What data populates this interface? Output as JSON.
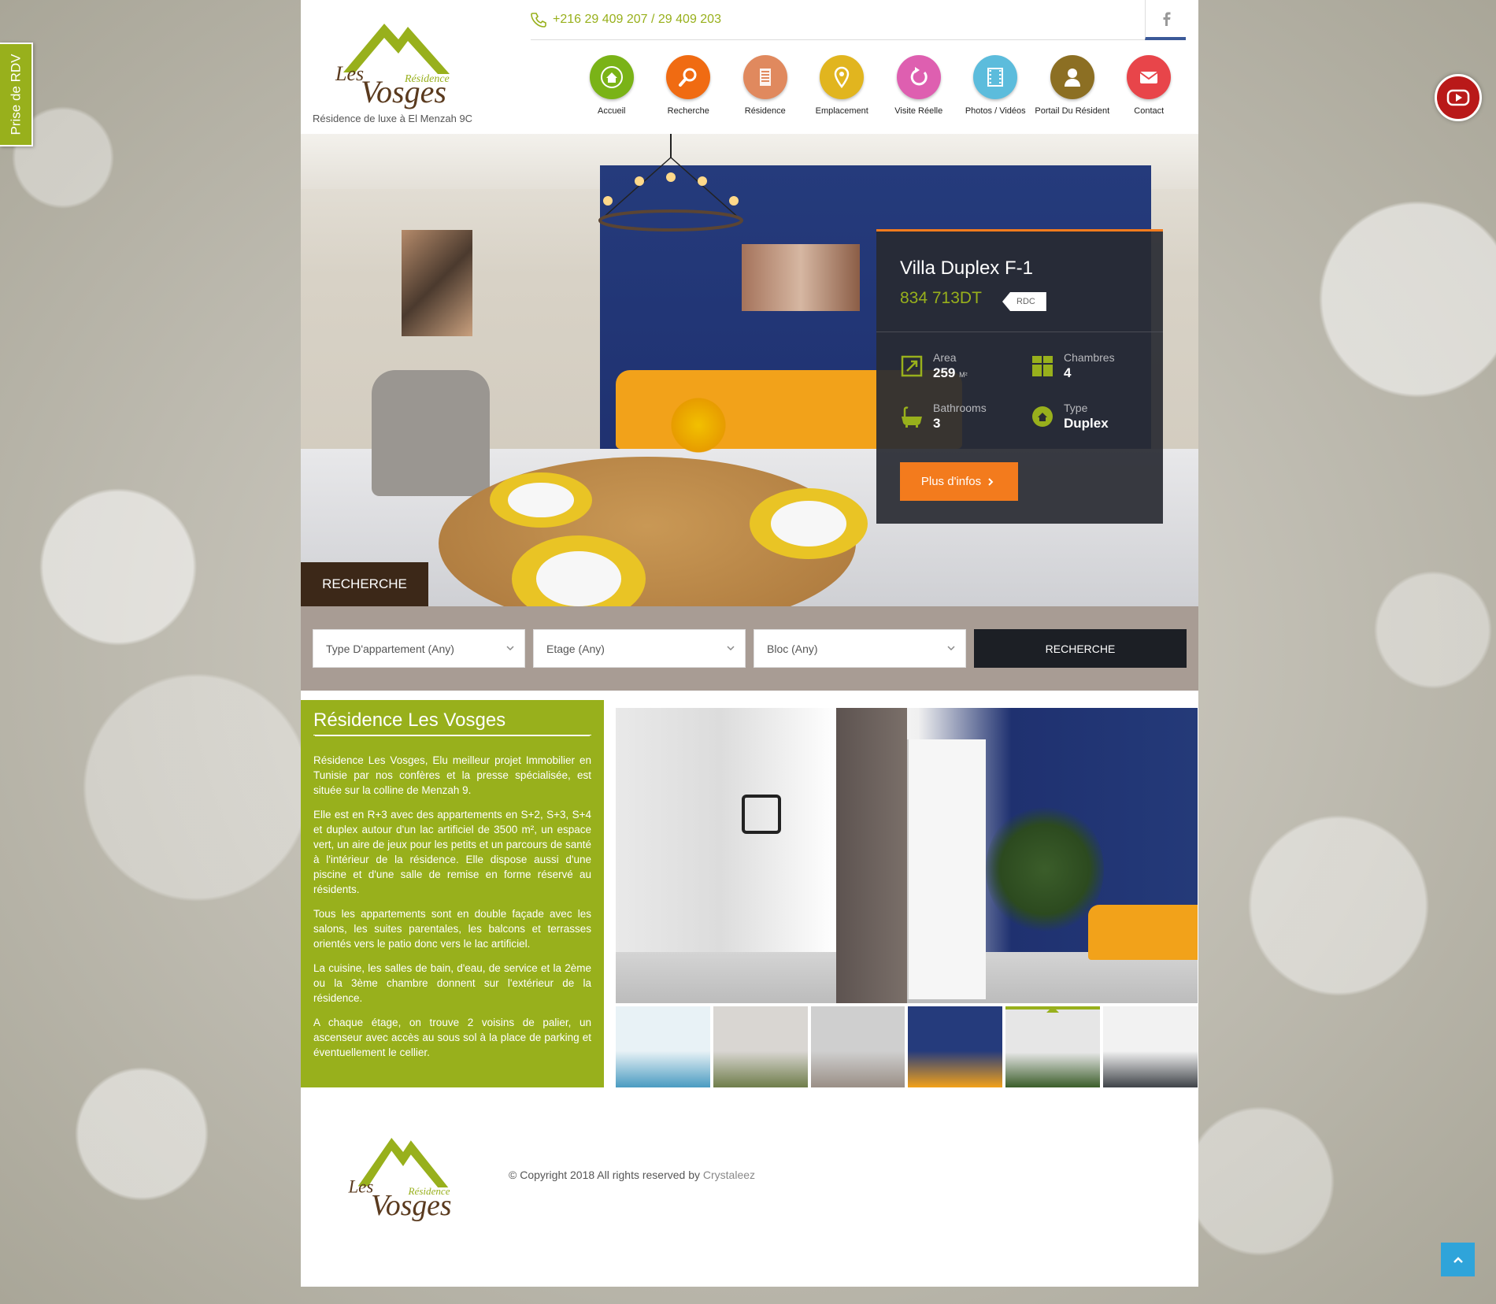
{
  "side_tab": {
    "label": "Prise de RDV"
  },
  "header": {
    "tagline": "Résidence de luxe à El Menzah 9C",
    "logo": {
      "line1": "Les",
      "line2": "Vosges",
      "line3": "Résidence"
    },
    "phone": "+216 29 409 207 / 29 409 203",
    "nav": [
      {
        "label": "Accueil",
        "icon": "home-icon",
        "color": "#7ab317"
      },
      {
        "label": "Recherche",
        "icon": "search-icon",
        "color": "#f06b12"
      },
      {
        "label": "Résidence",
        "icon": "building-icon",
        "color": "#e0895e"
      },
      {
        "label": "Emplacement",
        "icon": "location-pin-icon",
        "color": "#e1b51f"
      },
      {
        "label": "Visite Réelle",
        "icon": "refresh-icon",
        "color": "#de5fb0"
      },
      {
        "label": "Photos / Vidéos",
        "icon": "film-icon",
        "color": "#5cbcdc"
      },
      {
        "label": "Portail Du Résident",
        "icon": "user-icon",
        "color": "#8c6f23"
      },
      {
        "label": "Contact",
        "icon": "mail-icon",
        "color": "#e8454a"
      }
    ]
  },
  "property": {
    "title": "Villa Duplex F-1",
    "price": "834 713DT",
    "tag": "RDC",
    "area": {
      "label": "Area",
      "value": "259",
      "unit": "M²"
    },
    "rooms": {
      "label": "Chambres",
      "value": "4"
    },
    "bathrooms": {
      "label": "Bathrooms",
      "value": "3"
    },
    "type": {
      "label": "Type",
      "value": "Duplex"
    },
    "button": "Plus d'infos"
  },
  "search": {
    "tab": "RECHERCHE",
    "type_select": "Type D'appartement (Any)",
    "floor_select": "Etage (Any)",
    "block_select": "Bloc (Any)",
    "button": "RECHERCHE"
  },
  "about": {
    "title": "Résidence Les Vosges",
    "paragraphs": [
      "Résidence Les Vosges, Elu meilleur projet Immobilier en Tunisie par nos confères et la presse spécialisée, est située sur la colline de Menzah 9.",
      "Elle est en R+3 avec des appartements en S+2, S+3, S+4 et duplex autour d'un lac artificiel de 3500 m², un espace vert, un aire de jeux pour les petits et un parcours de santé à l'intérieur de la résidence. Elle dispose aussi d'une piscine et d'une salle de remise en forme réservé au résidents.",
      "Tous les appartements sont en double façade avec les salons, les suites parentales, les balcons et terrasses orientés vers le patio donc vers le lac artificiel.",
      "La cuisine, les salles de bain, d'eau, de service et la 2ème ou la 3ème chambre donnent sur l'extérieur de la résidence.",
      "A chaque étage, on trouve 2 voisins de palier, un ascenseur avec accès au sous sol à la place de parking et éventuellement le cellier."
    ]
  },
  "gallery": {
    "thumbnails": [
      {
        "name": "pool",
        "colors": [
          "#e8f2f6",
          "#4a9bc1"
        ]
      },
      {
        "name": "stairs",
        "colors": [
          "#d9d6d2",
          "#6f7d4a"
        ]
      },
      {
        "name": "courtyard",
        "colors": [
          "#cfcfcf",
          "#9a8f86"
        ]
      },
      {
        "name": "living-room",
        "colors": [
          "#253b7c",
          "#f2a21a"
        ]
      },
      {
        "name": "hallway",
        "colors": [
          "#e6e6e6",
          "#3b5d2a"
        ]
      },
      {
        "name": "kitchen",
        "colors": [
          "#f2f2f2",
          "#3f4348"
        ]
      }
    ],
    "active_index": 4
  },
  "footer": {
    "copyright": "© Copyright 2018 All rights reserved by",
    "brand": "Crystaleez"
  },
  "colors": {
    "accent_green": "#98b01c",
    "accent_orange": "#f37b1d",
    "dark": "#1c1f25",
    "search_tab": "#3c2818"
  }
}
